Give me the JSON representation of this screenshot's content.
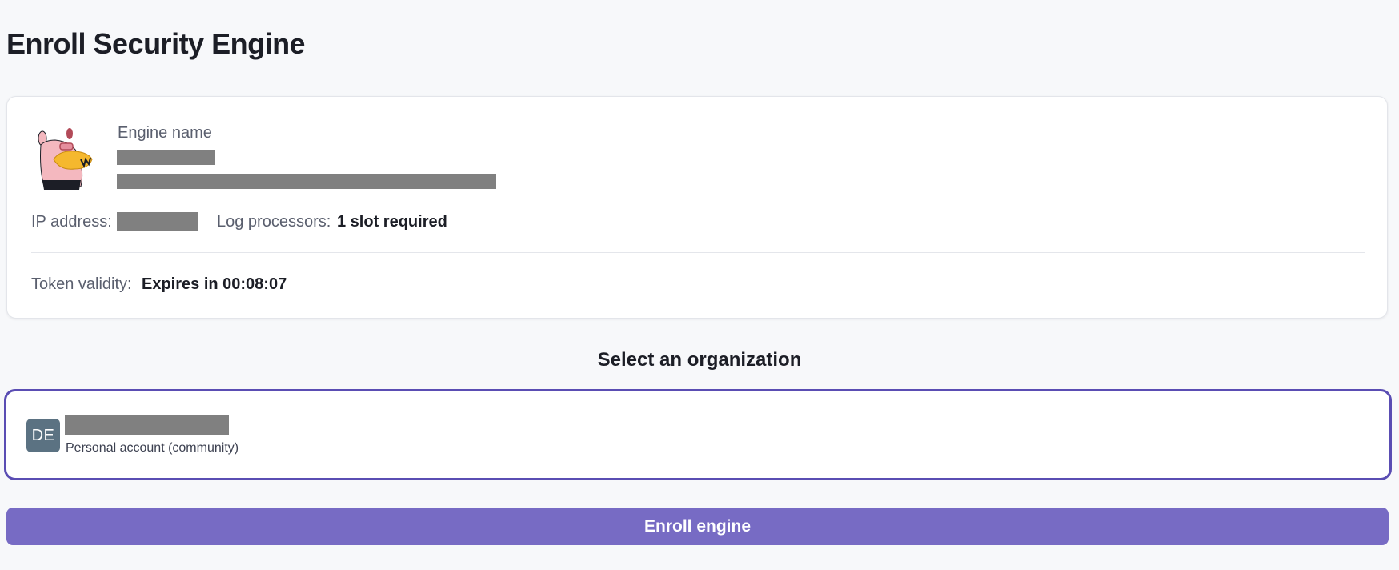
{
  "page": {
    "title": "Enroll Security Engine"
  },
  "engine": {
    "name_label": "Engine name",
    "ip_label": "IP address:",
    "log_processors_label": "Log processors:",
    "log_processors_value": "1 slot required",
    "token_label": "Token validity:",
    "token_value": "Expires in 00:08:07",
    "avatar_icon": "mascot-illustration"
  },
  "organization": {
    "section_title": "Select an organization",
    "selected": {
      "initials": "DE",
      "subtitle": "Personal account (community)",
      "avatar_color": "#5b7282",
      "selected_border_color": "#5a4db3"
    }
  },
  "actions": {
    "enroll_label": "Enroll engine",
    "enroll_color": "#776bc4"
  }
}
